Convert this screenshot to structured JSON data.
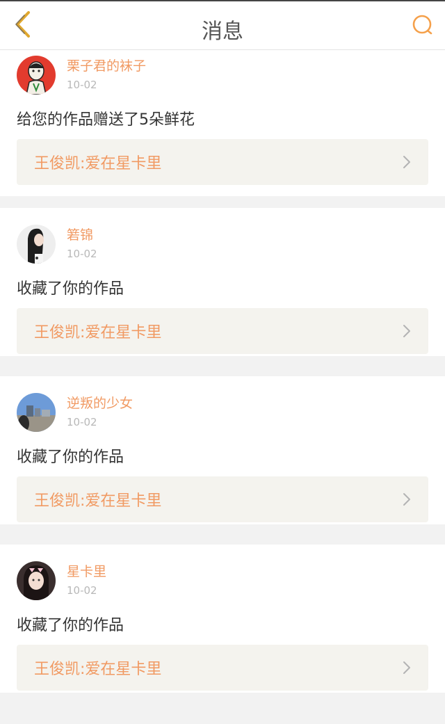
{
  "header": {
    "title": "消息",
    "back_icon": "chevron-left-icon",
    "search_icon": "search-icon",
    "accent": "#e0a830",
    "search_color": "#f5a04a"
  },
  "colors": {
    "username": "#f19a63",
    "date": "#b8b8b8",
    "work_bg": "#f4f3ee",
    "work_title": "#f19a63"
  },
  "notifications": [
    {
      "username": "栗子君的袜子",
      "date": "10-02",
      "message": "给您的作品赠送了5朵鲜花",
      "work_title": "王俊凯:爱在星卡里"
    },
    {
      "username": "箬锦",
      "date": "10-02",
      "message": "收藏了你的作品",
      "work_title": "王俊凯:爱在星卡里"
    },
    {
      "username": "逆叛的少女",
      "date": "10-02",
      "message": "收藏了你的作品",
      "work_title": "王俊凯:爱在星卡里"
    },
    {
      "username": "星卡里",
      "date": "10-02",
      "message": "收藏了你的作品",
      "work_title": "王俊凯:爱在星卡里"
    }
  ]
}
